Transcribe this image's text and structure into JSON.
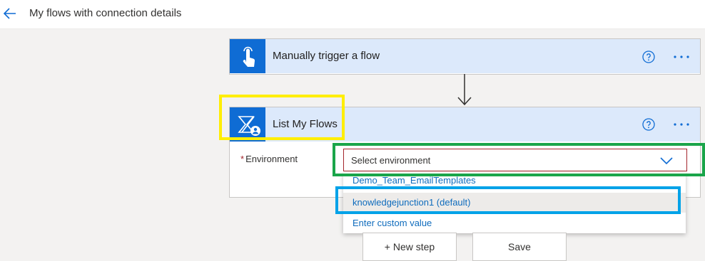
{
  "header": {
    "title": "My flows with connection details"
  },
  "trigger_card": {
    "title": "Manually trigger a flow"
  },
  "action_card": {
    "title": "List My Flows",
    "environment_label": "Environment",
    "required_mark": "*",
    "select_placeholder": "Select environment"
  },
  "dropdown": {
    "options": [
      {
        "label": "Demo_Team_EmailTemplates"
      },
      {
        "label": "knowledgejunction1 (default)"
      },
      {
        "label": "Enter custom value"
      }
    ]
  },
  "footer": {
    "new_step_label": "+ New step",
    "save_label": "Save"
  },
  "colors": {
    "accent": "#0f6cd4",
    "card_header": "#dce9fb",
    "annotation_yellow": "#ffee00",
    "annotation_green": "#1aa54a",
    "annotation_blue": "#00a2e8"
  }
}
